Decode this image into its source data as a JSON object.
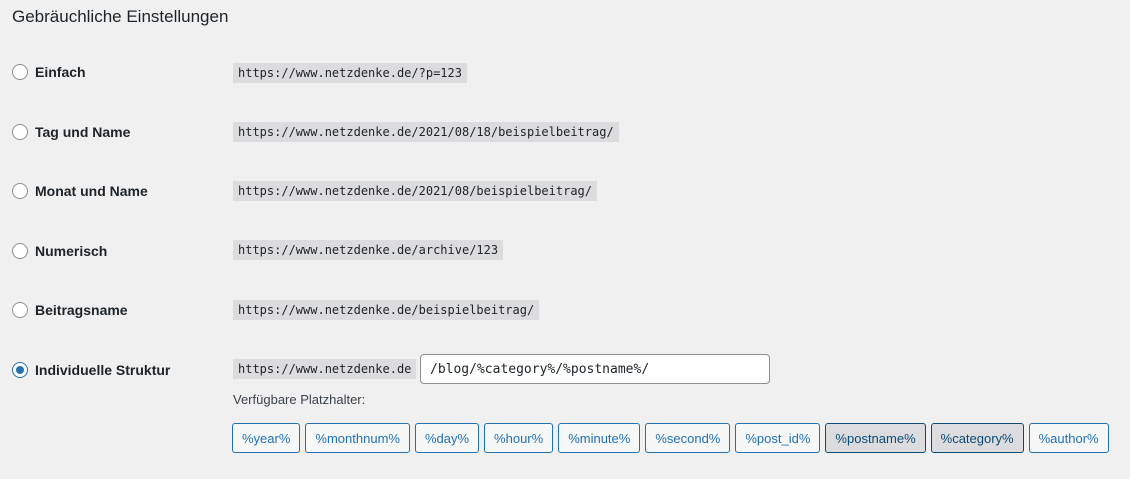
{
  "section": {
    "title": "Gebräuchliche Einstellungen"
  },
  "options": [
    {
      "label": "Einfach",
      "url": "https://www.netzdenke.de/?p=123",
      "selected": false
    },
    {
      "label": "Tag und Name",
      "url": "https://www.netzdenke.de/2021/08/18/beispielbeitrag/",
      "selected": false
    },
    {
      "label": "Monat und Name",
      "url": "https://www.netzdenke.de/2021/08/beispielbeitrag/",
      "selected": false
    },
    {
      "label": "Numerisch",
      "url": "https://www.netzdenke.de/archive/123",
      "selected": false
    },
    {
      "label": "Beitragsname",
      "url": "https://www.netzdenke.de/beispielbeitrag/",
      "selected": false
    }
  ],
  "custom": {
    "label": "Individuelle Struktur",
    "base_url": "https://www.netzdenke.de",
    "structure_value": "/blog/%category%/%postname%/",
    "selected": true,
    "placeholders_heading": "Verfügbare Platzhalter:",
    "tags": [
      {
        "label": "%year%",
        "active": false
      },
      {
        "label": "%monthnum%",
        "active": false
      },
      {
        "label": "%day%",
        "active": false
      },
      {
        "label": "%hour%",
        "active": false
      },
      {
        "label": "%minute%",
        "active": false
      },
      {
        "label": "%second%",
        "active": false
      },
      {
        "label": "%post_id%",
        "active": false
      },
      {
        "label": "%postname%",
        "active": true
      },
      {
        "label": "%category%",
        "active": true
      },
      {
        "label": "%author%",
        "active": false
      }
    ]
  },
  "colors": {
    "background": "#f0f0f1",
    "accent": "#2271b1",
    "code_background": "#dcdcde"
  }
}
